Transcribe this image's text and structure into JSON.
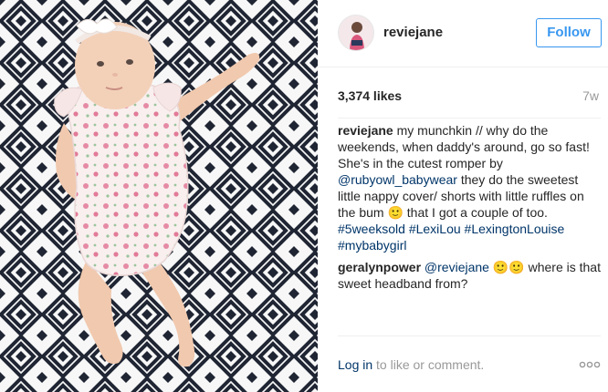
{
  "post": {
    "photo_icon": "baby-photo",
    "author": {
      "username": "reviejane",
      "avatar_icon": "profile-photo",
      "follow_label": "Follow"
    },
    "likes": "3,374 likes",
    "age": "7w",
    "caption": {
      "username": "reviejane",
      "line1": "my munchkin // why do the weekends, when daddy's around, go so fast!",
      "line2_before": "She's in the cutest romper by ",
      "mention": "@rubyowl_babywear",
      "line2_after": " they do the sweetest little nappy cover/ shorts with little ruffles on the bum 🙂 that I got a couple of too.",
      "hashtags": [
        "#5weeksold",
        "#LexiLou",
        "#LexingtonLouise",
        "#mybabygirl"
      ]
    },
    "comments": [
      {
        "username": "geralynpower",
        "mention": "@reviejane",
        "text": " 🙂🙂 where is that sweet headband from?"
      }
    ],
    "footer": {
      "login_label": "Log in",
      "rest_label": " to like or comment.",
      "more_icon": "more-options-icon"
    }
  },
  "colors": {
    "accent": "#3897f0",
    "link": "#003569",
    "muted": "#999999",
    "pattern_dark": "#1f2533"
  }
}
